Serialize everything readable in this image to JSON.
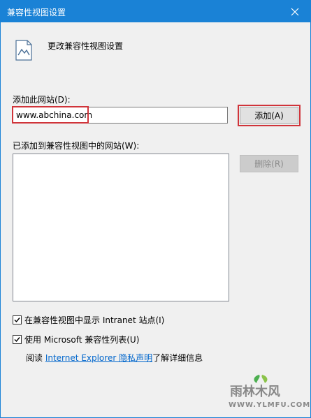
{
  "window": {
    "title": "兼容性视图设置"
  },
  "header": {
    "text": "更改兼容性视图设置"
  },
  "add_site": {
    "label": "添加此网站(D):",
    "value": "www.abchina.com",
    "button_label": "添加(A)"
  },
  "sites_list": {
    "label": "已添加到兼容性视图中的网站(W):",
    "items": [],
    "remove_button_label": "删除(R)"
  },
  "options": {
    "intranet": {
      "label": "在兼容性视图中显示 Intranet 站点(I)",
      "checked": true
    },
    "microsoft_list": {
      "label": "使用 Microsoft 兼容性列表(U)",
      "checked": true
    }
  },
  "footer": {
    "prefix": "阅读 ",
    "link_text": "Internet Explorer 隐私声明",
    "suffix": "了解详细信息"
  },
  "watermark": {
    "text": "雨林木风",
    "url": "WWW.YLMFU.COM"
  },
  "colors": {
    "accent": "#1a82d6",
    "highlight": "#d0343a",
    "link": "#0066cc"
  }
}
